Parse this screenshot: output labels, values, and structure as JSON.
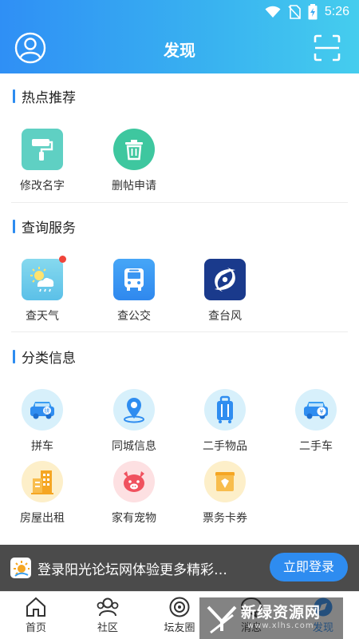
{
  "status_bar": {
    "time": "5:26"
  },
  "header": {
    "title": "发现"
  },
  "sections": [
    {
      "title": "热点推荐",
      "items": [
        {
          "label": "修改名字",
          "icon": "paint-roller-icon"
        },
        {
          "label": "删帖申请",
          "icon": "trash-icon"
        }
      ]
    },
    {
      "title": "查询服务",
      "items": [
        {
          "label": "查天气",
          "icon": "weather-icon"
        },
        {
          "label": "查公交",
          "icon": "bus-icon"
        },
        {
          "label": "查台风",
          "icon": "typhoon-icon"
        }
      ]
    },
    {
      "title": "分类信息",
      "items": [
        {
          "label": "拼车",
          "icon": "carpool-icon"
        },
        {
          "label": "同城信息",
          "icon": "location-pin-icon"
        },
        {
          "label": "二手物品",
          "icon": "suitcase-icon"
        },
        {
          "label": "二手车",
          "icon": "used-car-icon"
        },
        {
          "label": "房屋出租",
          "icon": "building-icon"
        },
        {
          "label": "家有宠物",
          "icon": "pet-icon"
        },
        {
          "label": "票务卡券",
          "icon": "ticket-icon"
        }
      ]
    }
  ],
  "login_banner": {
    "text": "登录阳光论坛网体验更多精彩…",
    "button_label": "立即登录"
  },
  "tabbar": [
    {
      "label": "首页",
      "icon": "home-icon",
      "active": false
    },
    {
      "label": "社区",
      "icon": "community-icon",
      "active": false
    },
    {
      "label": "坛友圈",
      "icon": "circle-icon",
      "active": false
    },
    {
      "label": "消息",
      "icon": "message-icon",
      "active": false
    },
    {
      "label": "发现",
      "icon": "discover-icon",
      "active": true
    }
  ],
  "watermark": {
    "title": "新绿资源网",
    "subtitle": "www.xlhs.com"
  },
  "colors": {
    "header_start": "#2f8ff5",
    "header_end": "#45cdee",
    "accent": "#2e8cf0",
    "badge": "#f0443a"
  }
}
